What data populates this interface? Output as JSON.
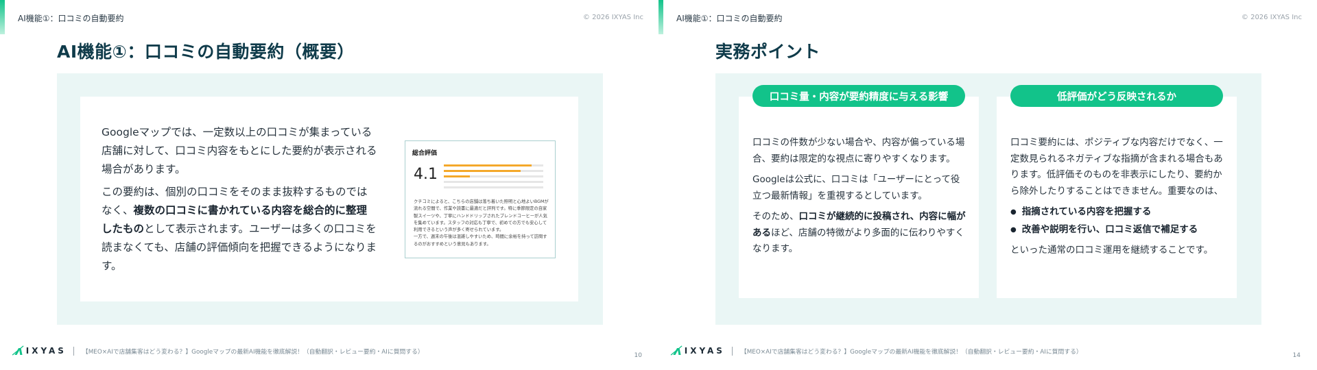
{
  "footer": {
    "logo": "IXYAS",
    "title": "【MEO×AIで店舗集客はどう変わる？】Googleマップの最新AI機能を徹底解説！（自動翻訳・レビュー要約・AIに質問する）"
  },
  "slide1": {
    "header_label": "AI機能①：口コミの自動要約",
    "copyright": "© 2026 IXYAS Inc",
    "title": "AI機能①：口コミの自動要約（概要）",
    "para1": "Googleマップでは、一定数以上の口コミが集まっている店舗に対して、口コミ内容をもとにした要約が表示される場合があります。",
    "para2_pre": "この要約は、個別の口コミをそのまま抜粋するものではなく、",
    "para2_bold": "複数の口コミに書かれている内容を総合的に整理したもの",
    "para2_post": "として表示されます。ユーザーは多くの口コミを読まなくても、店舗の評価傾向を把握できるようになります。",
    "review": {
      "title": "総合評価",
      "score": "4.1",
      "bars": [
        0.88,
        0.77,
        0.26,
        0.0,
        0.0
      ],
      "desc": "クチコミによると、こちらの店舗は落ち着いた照明と心地よいBGMが流れる空間で、作業や読書に最適だと評判です。特に季節限定の自家製スイーツや、丁寧にハンドドリップされたブレンドコーヒーが人気を集めています。スタッフの対応も丁寧で、初めての方でも安心して利用できるという声が多く寄せられています。\n一方で、週末の午後は混雑しやすいため、時間に余裕を持って訪問するのがおすすめという意見もあります。"
    },
    "page": "10"
  },
  "slide2": {
    "header_label": "AI機能①：口コミの自動要約",
    "copyright": "© 2026 IXYAS Inc",
    "title": "実務ポイント",
    "left": {
      "pill": "口コミ量・内容が要約精度に与える影響",
      "p1": "口コミの件数が少ない場合や、内容が偏っている場合、要約は限定的な視点に寄りやすくなります。",
      "p2": "Googleは公式に、口コミは「ユーザーにとって役立つ最新情報」を重視するとしています。",
      "p3_pre": "そのため、",
      "p3_bold": "口コミが継続的に投稿され、内容に幅がある",
      "p3_post": "ほど、店舗の特徴がより多面的に伝わりやすくなります。"
    },
    "right": {
      "pill": "低評価がどう反映されるか",
      "p1": "口コミ要約には、ポジティブな内容だけでなく、一定数見られるネガティブな指摘が含まれる場合もあります。低評価そのものを非表示にしたり、要約から除外したりすることはできません。重要なのは、",
      "bullets": [
        "指摘されている内容を把握する",
        "改善や説明を行い、口コミ返信で補足する"
      ],
      "p2": "といった通常の口コミ運用を継続することです。"
    },
    "page": "14"
  },
  "colors": {
    "accent": "#12c38a",
    "panel": "#eaf6f5",
    "title": "#0f3b4a",
    "star": "#f4a82a"
  }
}
